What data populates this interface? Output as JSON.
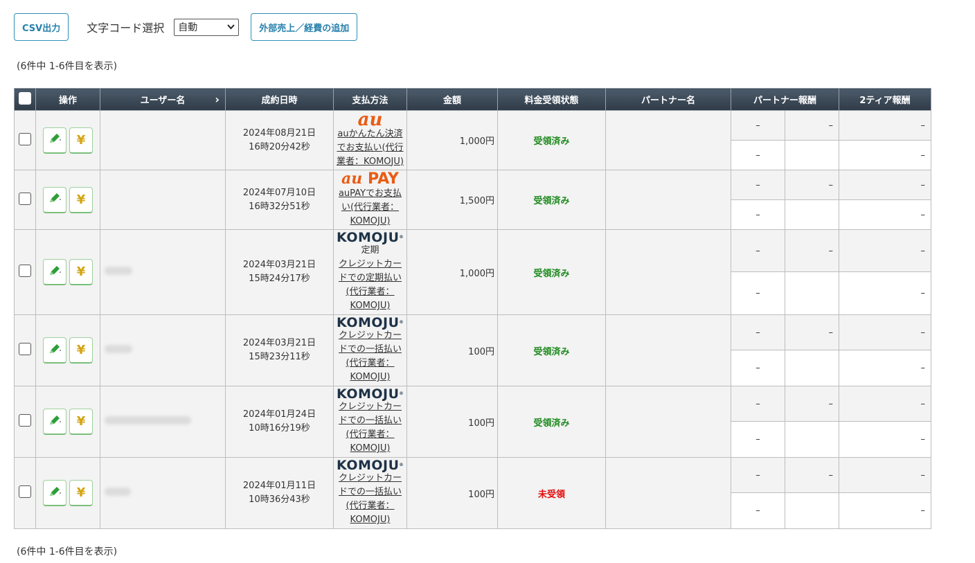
{
  "toolbar": {
    "csv_button": "CSV出力",
    "encoding_label": "文字コード選択",
    "encoding_value": "自動",
    "add_button": "外部売上／経費の追加"
  },
  "count_text": "(6件中 1-6件目を表示)",
  "table": {
    "headers": {
      "ops": "操作",
      "user": "ユーザー名",
      "user_sort": "›",
      "date": "成約日時",
      "payment": "支払方法",
      "amount": "金額",
      "status": "料金受領状態",
      "partner": "パートナー名",
      "partner_fee": "パートナー報酬",
      "tier2_fee": "2ティア報酬"
    },
    "dash": "–",
    "rows": [
      {
        "date1": "2024年08月21日",
        "date2": "16時20分42秒",
        "logo": "au",
        "plan": "",
        "pay_lines": [
          "auかんたん決済",
          "でお支払い(代行",
          "業者：KOMOJU)"
        ],
        "amount": "1,000円",
        "status": "受領済み",
        "status_type": "ok",
        "user_blur": 0
      },
      {
        "date1": "2024年07月10日",
        "date2": "16時32分51秒",
        "logo": "aupay",
        "plan": "",
        "pay_lines": [
          "auPAYでお支払",
          "い(代行業者：",
          "KOMOJU)"
        ],
        "amount": "1,500円",
        "status": "受領済み",
        "status_type": "ok",
        "user_blur": 0
      },
      {
        "date1": "2024年03月21日",
        "date2": "15時24分17秒",
        "logo": "komoju",
        "plan": "定期",
        "pay_lines": [
          "クレジットカー",
          "ドでの定期払い",
          "(代行業者：",
          "KOMOJU)"
        ],
        "amount": "1,000円",
        "status": "受領済み",
        "status_type": "ok",
        "user_blur": 40
      },
      {
        "date1": "2024年03月21日",
        "date2": "15時23分11秒",
        "logo": "komoju",
        "plan": "",
        "pay_lines": [
          "クレジットカー",
          "ドでの一括払い",
          "(代行業者：",
          "KOMOJU)"
        ],
        "amount": "100円",
        "status": "受領済み",
        "status_type": "ok",
        "user_blur": 40
      },
      {
        "date1": "2024年01月24日",
        "date2": "10時16分19秒",
        "logo": "komoju",
        "plan": "",
        "pay_lines": [
          "クレジットカー",
          "ドでの一括払い",
          "(代行業者：",
          "KOMOJU)"
        ],
        "amount": "100円",
        "status": "受領済み",
        "status_type": "ok",
        "user_blur": 125
      },
      {
        "date1": "2024年01月11日",
        "date2": "10時36分43秒",
        "logo": "komoju",
        "plan": "",
        "pay_lines": [
          "クレジットカー",
          "ドでの一括払い",
          "(代行業者：",
          "KOMOJU)"
        ],
        "amount": "100円",
        "status": "未受領",
        "status_type": "ng",
        "user_blur": 38
      }
    ]
  },
  "logos": {
    "au": "au",
    "aupay_au": "au",
    "aupay_pay": "PAY",
    "komoju": "KOMOJU",
    "komoju_mark": "®"
  },
  "icons": {
    "edit": "pencil-icon",
    "payment": "yen-icon",
    "select": "chevron-down-icon",
    "sort": "chevron-right-icon"
  },
  "colors": {
    "accent": "#2680ad",
    "header_bg": "#3a4753",
    "received": "#1f8a1f",
    "unreceived": "#e00d0d",
    "brand_au": "#ea5b13",
    "brand_komoju": "#1e3247",
    "pencil": "#2e9e3a",
    "yen": "#d4a514"
  }
}
